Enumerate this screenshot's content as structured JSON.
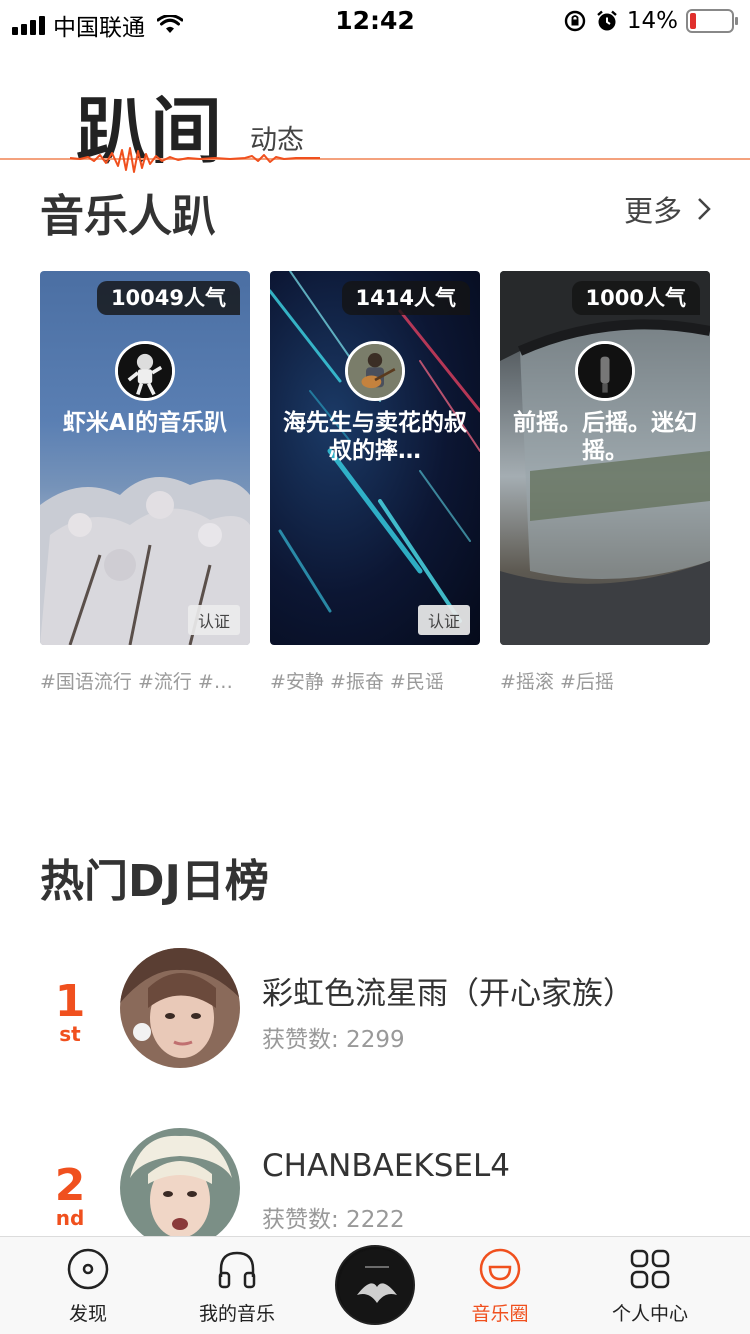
{
  "status_bar": {
    "carrier": "中国联通",
    "time": "12:42",
    "battery_percent": "14%",
    "battery_level": 0.14
  },
  "header": {
    "active_tab": "趴间",
    "inactive_tab": "动态"
  },
  "music_section": {
    "title": "音乐人趴",
    "more_label": "更多"
  },
  "cards": [
    {
      "popularity": "10049人气",
      "title": "虾米AI的音乐趴",
      "badge": "认证",
      "tags": "#国语流行 #流行 #…"
    },
    {
      "popularity": "1414人气",
      "title": "海先生与卖花的叔叔的摔…",
      "badge": "认证",
      "tags": "#安静 #振奋 #民谣"
    },
    {
      "popularity": "1000人气",
      "title": "前摇。后摇。迷幻摇。",
      "badge": "",
      "tags": "#摇滚 #后摇"
    }
  ],
  "dj_section": {
    "title": "热门DJ日榜",
    "items": [
      {
        "rank": "1",
        "suffix": "st",
        "name": "彩虹色流星雨（开心家族）",
        "likes": "获赞数: 2299"
      },
      {
        "rank": "2",
        "suffix": "nd",
        "name": "CHANBAEKSEL4",
        "likes": "获赞数: 2222"
      }
    ]
  },
  "bottom_nav": {
    "items": [
      {
        "label": "发现",
        "icon": "disc-icon"
      },
      {
        "label": "我的音乐",
        "icon": "headphones-icon"
      },
      {
        "label": "音乐圈",
        "icon": "smile-icon"
      },
      {
        "label": "个人中心",
        "icon": "grid-icon"
      }
    ]
  },
  "colors": {
    "accent": "#f0501e",
    "header_line": "#f4a27e"
  }
}
